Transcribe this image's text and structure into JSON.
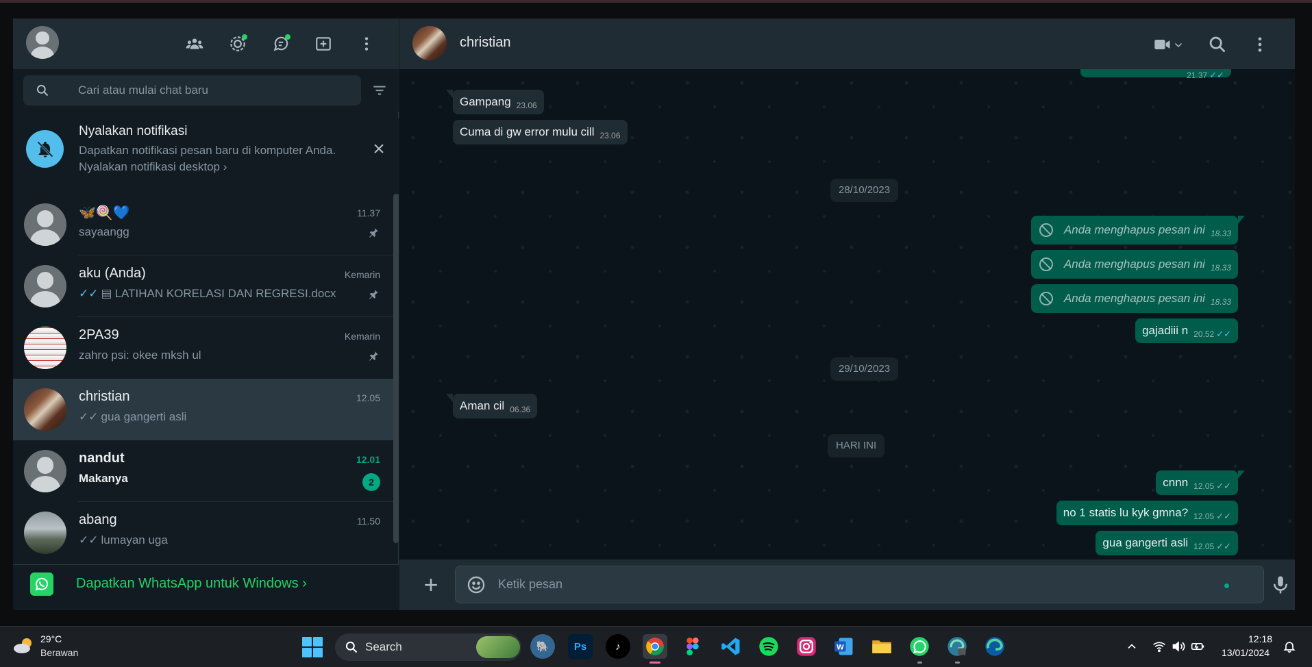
{
  "sidebar": {
    "search": {
      "placeholder": "Cari atau mulai chat baru"
    },
    "notification": {
      "title": "Nyalakan notifikasi",
      "description": "Dapatkan notifikasi pesan baru di komputer Anda.",
      "link": "Nyalakan notifikasi desktop"
    },
    "chats": [
      {
        "name": "🦋🍭💙",
        "preview": "sayaangg",
        "time": "11.37",
        "pinned": true
      },
      {
        "name": "aku (Anda)",
        "preview": "LATIHAN KORELASI DAN REGRESI.docx",
        "time": "Kemarin",
        "pinned": true
      },
      {
        "name": "2PA39",
        "preview": "zahro psi: okee mksh ul",
        "time": "Kemarin",
        "pinned": true
      },
      {
        "name": "christian",
        "preview": "gua gangerti asli",
        "time": "12.05",
        "active": true
      },
      {
        "name": "nandut",
        "preview": "Makanya",
        "time": "12.01",
        "unread": "2"
      },
      {
        "name": "abang",
        "preview": "lumayan uga",
        "time": "11.50"
      }
    ],
    "banner": "Dapatkan WhatsApp untuk Windows"
  },
  "conversation": {
    "contact_name": "christian",
    "top_partial_time": "21.37",
    "messages": [
      {
        "text": "Gampang",
        "time": "23.06",
        "dir": "in"
      },
      {
        "text": "Cuma di gw error mulu cill",
        "time": "23.06",
        "dir": "in"
      },
      {
        "date": "28/10/2023"
      },
      {
        "text": "Anda menghapus pesan ini",
        "time": "18.33",
        "dir": "out",
        "deleted": true
      },
      {
        "text": "Anda menghapus pesan ini",
        "time": "18.33",
        "dir": "out",
        "deleted": true
      },
      {
        "text": "Anda menghapus pesan ini",
        "time": "18.33",
        "dir": "out",
        "deleted": true
      },
      {
        "text": "gajadiii n",
        "time": "20.52",
        "dir": "out",
        "read": true
      },
      {
        "date": "29/10/2023"
      },
      {
        "text": "Aman cil",
        "time": "06.36",
        "dir": "in"
      },
      {
        "date": "HARI INI"
      },
      {
        "text": "cnnn",
        "time": "12.05",
        "dir": "out"
      },
      {
        "text": "no 1 statis lu kyk gmna?",
        "time": "12.05",
        "dir": "out"
      },
      {
        "text": "gua gangerti asli",
        "time": "12.05",
        "dir": "out"
      }
    ],
    "composer": {
      "placeholder": "Ketik pesan"
    }
  },
  "taskbar": {
    "weather": {
      "temp": "29°C",
      "desc": "Berawan"
    },
    "search_label": "Search",
    "apps": [
      "postgresql-icon",
      "photoshop-icon",
      "tiktok-icon",
      "chrome-icon",
      "figma-icon",
      "vscode-icon",
      "spotify-icon",
      "instagram-icon",
      "word-icon",
      "file-explorer-icon",
      "whatsapp-icon",
      "edge-dev-icon",
      "edge-icon"
    ],
    "clock": {
      "time": "12:18",
      "date": "13/01/2024"
    }
  },
  "colors": {
    "accent": "#00a884",
    "bubble_out": "#005c4b",
    "bubble_in": "#202c33",
    "panel": "#202c33",
    "background": "#111b21"
  }
}
